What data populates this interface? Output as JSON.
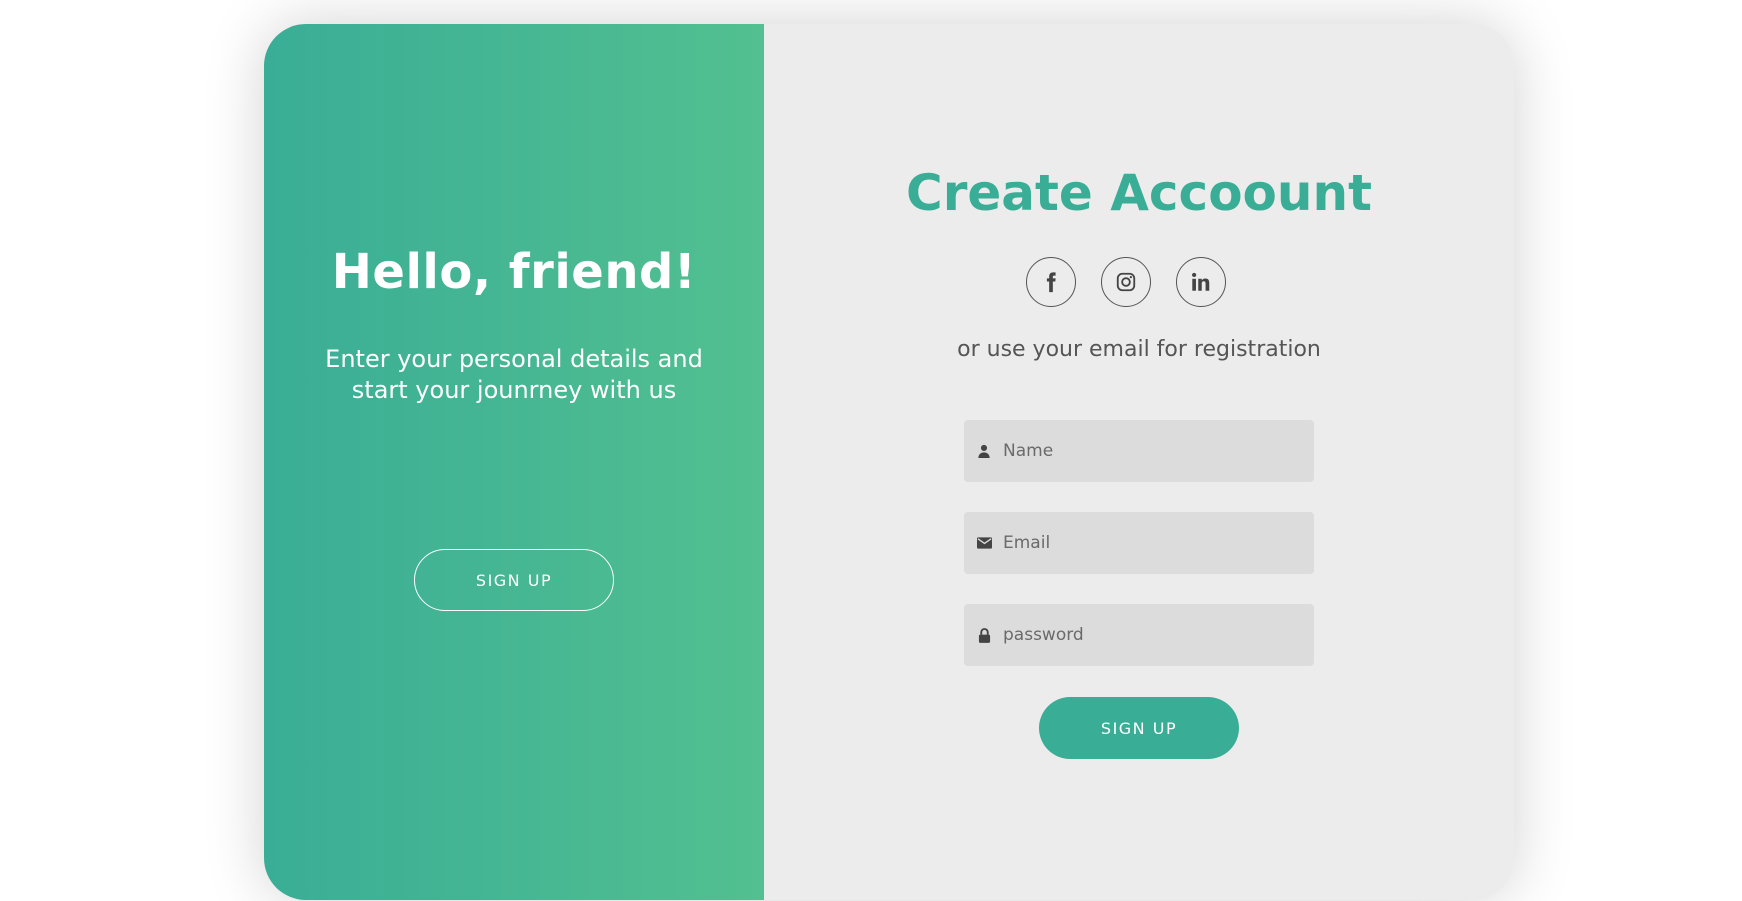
{
  "welcome_panel": {
    "title": "Hello, friend!",
    "message": "Enter your personal details and start your jounrney with us",
    "signup_button_label": "SIGN UP"
  },
  "signup_form": {
    "title": "Create Accoount",
    "social_buttons": [
      {
        "name": "facebook",
        "icon": "facebook-icon"
      },
      {
        "name": "instagram",
        "icon": "instagram-icon"
      },
      {
        "name": "linkedin",
        "icon": "linkedin-icon"
      }
    ],
    "alt_text": "or use your email for registration",
    "fields": {
      "name": {
        "placeholder": "Name",
        "value": "",
        "icon": "user-icon"
      },
      "email": {
        "placeholder": "Email",
        "value": "",
        "icon": "envelope-icon"
      },
      "password": {
        "placeholder": "password",
        "value": "",
        "icon": "lock-icon"
      }
    },
    "submit_label": "SIGN UP"
  },
  "colors": {
    "accent": "#3aad96",
    "gradient_start": "#3aad96",
    "gradient_end": "#52c090",
    "panel_background": "#ececec",
    "field_background": "#dcdcdc"
  }
}
